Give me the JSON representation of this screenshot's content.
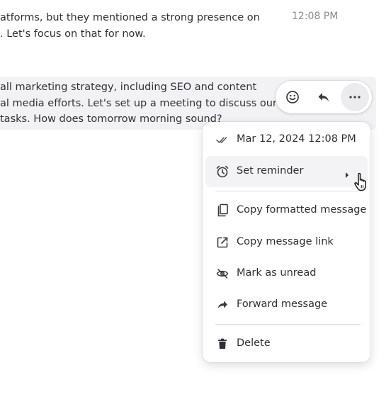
{
  "messages": [
    {
      "lines": [
        "atforms, but they mentioned a strong presence on",
        ". Let's focus on that for now."
      ],
      "time": "12:08 PM"
    },
    {
      "lines": [
        "all marketing strategy, including SEO and content",
        "al media efforts. Let's set up a meeting to discuss our",
        "tasks. How does tomorrow morning sound?"
      ]
    }
  ],
  "action_bar": {
    "buttons": [
      {
        "icon": "emoji-icon"
      },
      {
        "icon": "reply-icon"
      },
      {
        "icon": "more-icon"
      }
    ]
  },
  "menu": {
    "items": [
      {
        "label": "Mar 12, 2024 12:08 PM",
        "icon": "double-check-icon"
      },
      {
        "label": "Set reminder",
        "icon": "alarm-clock-icon"
      },
      {
        "label": "Copy formatted message",
        "icon": "copy-icon"
      },
      {
        "label": "Copy message link",
        "icon": "external-link-icon"
      },
      {
        "label": "Mark as unread",
        "icon": "eye-off-icon"
      },
      {
        "label": "Forward message",
        "icon": "forward-icon"
      },
      {
        "label": "Delete",
        "icon": "trash-icon"
      }
    ]
  }
}
